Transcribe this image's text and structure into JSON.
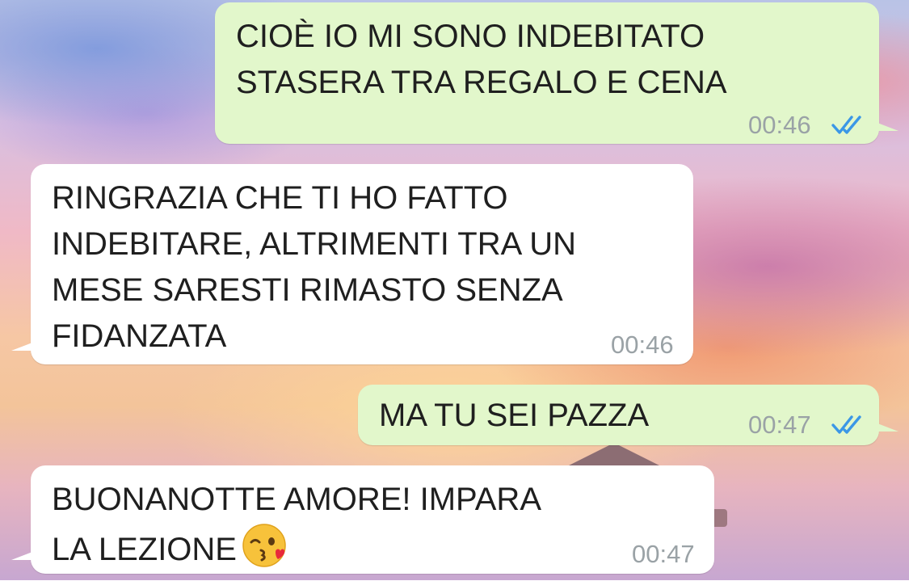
{
  "colors": {
    "outgoing_bubble": "#e2f7cb",
    "incoming_bubble": "#ffffff",
    "read_ticks": "#3b97e6",
    "timestamp": "#9aa2a6"
  },
  "messages": [
    {
      "direction": "outgoing",
      "text": "CIOÈ IO MI SONO INDEBITATO\nSTASERA TRA REGALO E CENA",
      "time": "00:46",
      "status_icon": "double-check-read-icon"
    },
    {
      "direction": "incoming",
      "text": "RINGRAZIA CHE TI HO FATTO\nINDEBITARE, ALTRIMENTI TRA UN\nMESE SARESTI RIMASTO SENZA\nFIDANZATA",
      "time": "00:46"
    },
    {
      "direction": "outgoing",
      "text": "MA TU SEI PAZZA",
      "time": "00:47",
      "status_icon": "double-check-read-icon"
    },
    {
      "direction": "incoming",
      "text": "BUONANOTTE AMORE! IMPARA\nLA LEZIONE",
      "emoji": "kissing-face-heart-emoji",
      "time": "00:47"
    }
  ]
}
